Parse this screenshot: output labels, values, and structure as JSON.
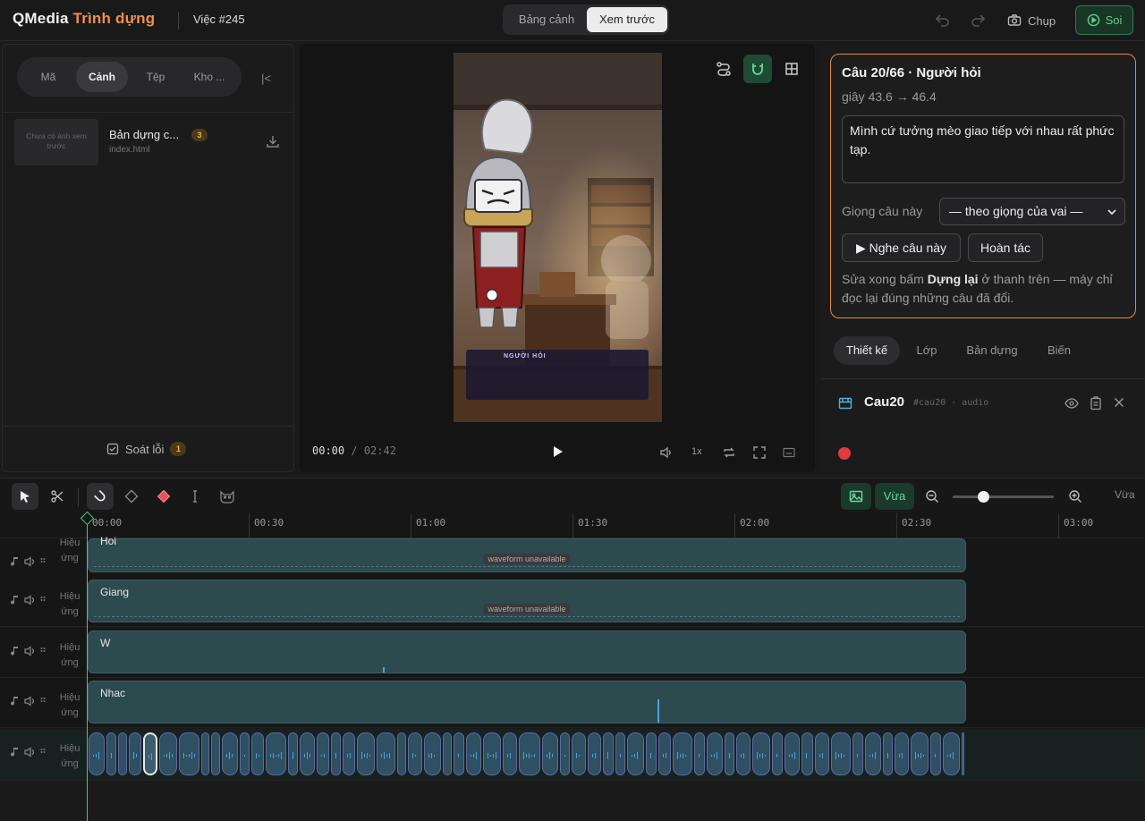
{
  "app": {
    "brand": "QMedia",
    "brand_accent": "Trình dựng",
    "job": "Việc #245",
    "accent_color": "#f0904a",
    "ok_color": "#3ccc83"
  },
  "view_toggle": {
    "options": [
      "Bảng cảnh",
      "Xem trước"
    ],
    "selected": "Xem trước"
  },
  "topbar": {
    "capture_label": "Chụp",
    "watch_label": "Soi"
  },
  "left_panel": {
    "tabs": [
      "Mã",
      "Cảnh",
      "Tệp",
      "Kho ..."
    ],
    "active_tab": "Cảnh",
    "collapse_glyph": "|<",
    "items": [
      {
        "thumbnail_text": "Chưa có ảnh xem trước",
        "title": "Bản dựng c...",
        "badge": "3",
        "subtitle": "index.html"
      }
    ],
    "footer": {
      "label": "Soát lỗi",
      "badge": "1"
    }
  },
  "preview": {
    "caption": "NGƯỜI HỎI",
    "current_time": "00:00",
    "separator": "/",
    "total_time": "02:42",
    "speed": "1x"
  },
  "sentence_card": {
    "title": "Câu 20/66 · Người hỏi",
    "range": "giây 43.6 → 46.4",
    "text": "Mình cứ tưởng mèo giao tiếp với nhau rất phức tạp.",
    "voice_label": "Giọng câu này",
    "voice_value": "— theo giọng của vai —",
    "listen_button": "▶ Nghe câu này",
    "undo_button": "Hoàn tác",
    "note_before": "Sửa xong bấm ",
    "note_bold": "Dựng lại",
    "note_after": " ở thanh trên — máy chỉ đọc lại đúng những câu đã đổi."
  },
  "right_tabs": {
    "items": [
      "Thiết kế",
      "Lớp",
      "Bản dựng",
      "Biến"
    ],
    "active": "Thiết kế"
  },
  "layer": {
    "name": "Cau20",
    "meta": "#cau20 · audio"
  },
  "timeline": {
    "zoom_fit_label": "Vừa",
    "zoom_right_label": "Vừa",
    "zoom_level": 0.3,
    "ruler": [
      "00:00",
      "00:30",
      "01:00",
      "01:30",
      "02:00",
      "02:30",
      "03:00"
    ],
    "track_kind_label": "Hiệu ứng",
    "tracks": [
      {
        "clip": "Hoi",
        "waveform": "waveform unavailable"
      },
      {
        "clip": "Giang",
        "waveform": "waveform unavailable"
      },
      {
        "clip": "W"
      },
      {
        "clip": "Nhac"
      },
      {
        "clip": ""
      }
    ]
  }
}
